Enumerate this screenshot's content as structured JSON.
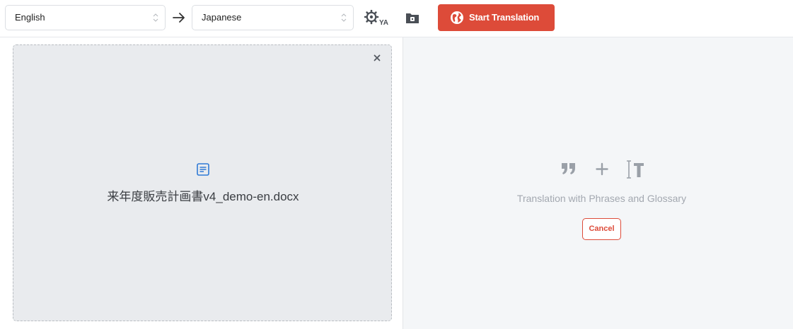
{
  "toolbar": {
    "source_language": "English",
    "target_language": "Japanese",
    "swap_arrow": "→",
    "settings_icon": "gear-translate-icon",
    "folder_icon": "folder-icon",
    "start_button_label": "Start Translation",
    "start_button_color": "#dd4b39"
  },
  "left_pane": {
    "file_name": "来年度販売計画書v4_demo-en.docx",
    "close_symbol": "×",
    "file_icon": "document-icon"
  },
  "right_pane": {
    "hint_text": "Translation with Phrases and Glossary",
    "cancel_label": "Cancel",
    "icons": [
      "quote-icon",
      "plus-icon",
      "text-cursor-icon"
    ]
  }
}
